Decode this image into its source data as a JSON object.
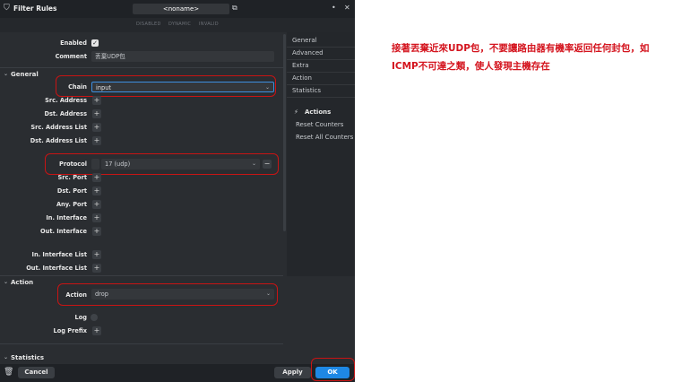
{
  "window": {
    "title": "Filter Rules",
    "name_value": "<noname>",
    "status_flags": [
      "DISABLED",
      "DYNAMIC",
      "INVALID"
    ]
  },
  "form": {
    "enabled_label": "Enabled",
    "comment_label": "Comment",
    "comment_value": "丟棄UDP包",
    "general_section": "General",
    "chain_label": "Chain",
    "chain_value": "input",
    "src_address_label": "Src. Address",
    "dst_address_label": "Dst. Address",
    "src_address_list_label": "Src. Address List",
    "dst_address_list_label": "Dst. Address List",
    "protocol_label": "Protocol",
    "protocol_value": "17 (udp)",
    "src_port_label": "Src. Port",
    "dst_port_label": "Dst. Port",
    "any_port_label": "Any. Port",
    "in_interface_label": "In. Interface",
    "out_interface_label": "Out. Interface",
    "in_interface_list_label": "In. Interface List",
    "out_interface_list_label": "Out. Interface List",
    "action_section": "Action",
    "action_label": "Action",
    "action_value": "drop",
    "log_label": "Log",
    "log_prefix_label": "Log Prefix",
    "statistics_section": "Statistics"
  },
  "sidebar": {
    "items": [
      "General",
      "Advanced",
      "Extra",
      "Action",
      "Statistics"
    ],
    "actions_header": "Actions",
    "action_items": [
      "Reset Counters",
      "Reset All Counters"
    ]
  },
  "bottom": {
    "cancel": "Cancel",
    "apply": "Apply",
    "ok": "OK"
  },
  "annotation": {
    "line1": "接著丟棄近來UDP包，不要讓路由器有機率返回任何封包，如",
    "line2": "ICMP不可達之類，使人發現主機存在"
  },
  "colors": {
    "accent": "#1e88e5",
    "annotation_red": "#d4141e",
    "highlight_box": "#c81414"
  }
}
